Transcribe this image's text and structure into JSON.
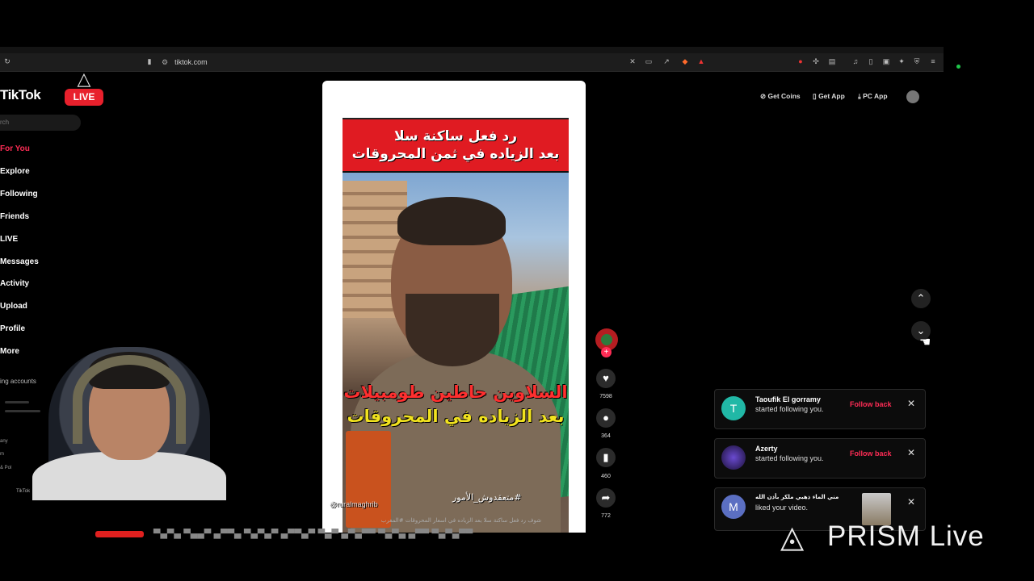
{
  "browser": {
    "url": "tiktok.com"
  },
  "live": {
    "badge": "LIVE"
  },
  "sidebar": {
    "brand": "TikTok",
    "search_placeholder": "rch",
    "items": [
      {
        "label": "For You",
        "active": true
      },
      {
        "label": "Explore"
      },
      {
        "label": "Following"
      },
      {
        "label": "Friends"
      },
      {
        "label": "LIVE"
      },
      {
        "label": "Messages"
      },
      {
        "label": "Activity"
      },
      {
        "label": "Upload"
      },
      {
        "label": "Profile"
      },
      {
        "label": "More"
      }
    ],
    "following_accounts": "ing accounts",
    "footer": [
      "any",
      "m",
      "& Pol",
      "TikTok"
    ]
  },
  "topbar": {
    "get_coins": "Get Coins",
    "get_app": "Get App",
    "pc_app": "PC App"
  },
  "video": {
    "banner_line1": "رد فعل ساكنة سلا",
    "banner_line2": "بعد الزياده في ثمن المحروقات",
    "caption_line1": "السلاوين حاطين طومبيلات",
    "caption_line2": "بعد الزياده في المحروقات",
    "hashtag": "#متعقدوش_الأمور",
    "username": "@ruralmaghrib",
    "description": "شوف رد فعل ساكنة سلا بعد الزياده في اسعار المحروقات #المغرب"
  },
  "actions": {
    "likes": "7598",
    "comments": "364",
    "saves": "460",
    "shares": "772"
  },
  "notifications": [
    {
      "initial": "T",
      "name": "Taoufik El gorramy",
      "text": "started following you.",
      "action": "Follow back",
      "color": "#21b8a6"
    },
    {
      "initial": "",
      "name": "Azerty",
      "text": "started following you.",
      "action": "Follow back",
      "color": "#3a2c6b"
    },
    {
      "initial": "M",
      "name": "مني الماء ذهبي ملكر بأذن الله",
      "text": "liked your video.",
      "action": "",
      "color": "#5b6fc2"
    }
  ],
  "stream": {
    "brand": "PRISM Live"
  },
  "colors": {
    "accent": "#fe2c55",
    "live_red": "#e8202c"
  }
}
